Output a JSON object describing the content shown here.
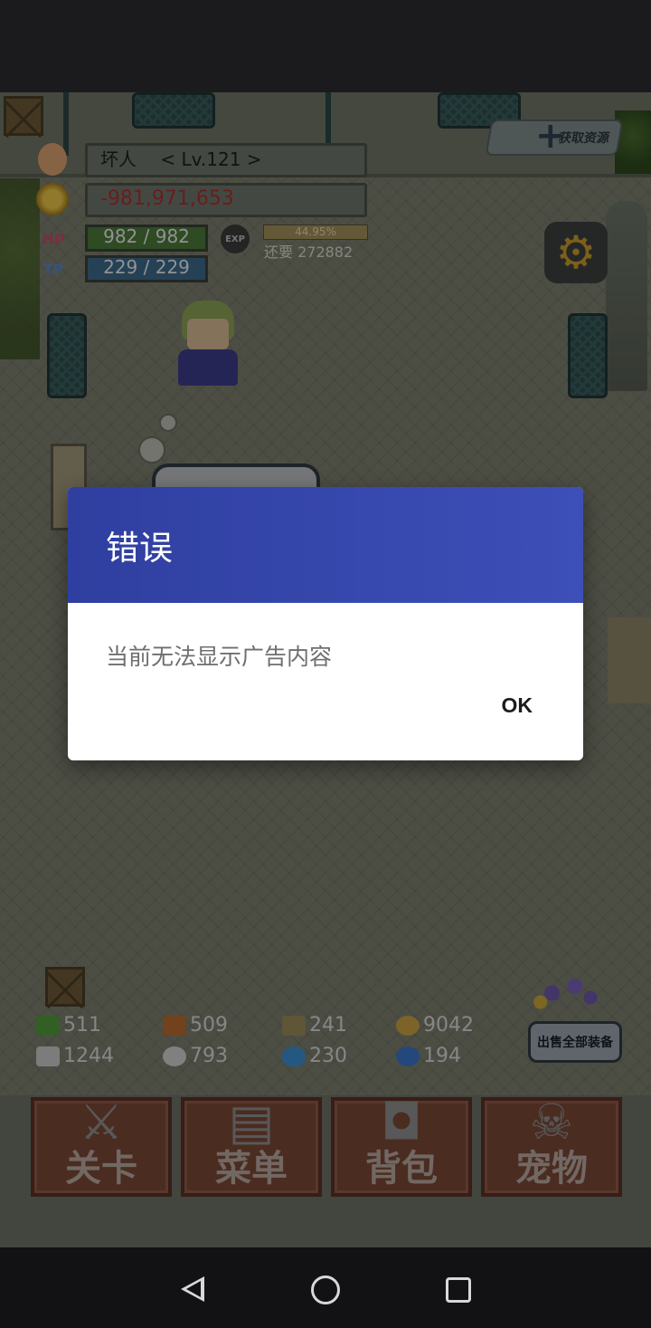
{
  "hud": {
    "player_name": "坏人",
    "level": "< Lv.121 >",
    "gold": "-981,971,653",
    "hp": "982 / 982",
    "tp": "229 / 229",
    "hp_label": "HP",
    "tp_label": "TP",
    "exp_label": "EXP",
    "exp_percent": "44.95%",
    "exp_remaining": "还要 272882"
  },
  "collect_button": {
    "label": "获取资源",
    "icon": "plus-orb-icon"
  },
  "settings_icon": "gear-icon",
  "resources": [
    {
      "icon": "herb-icon",
      "value": "511",
      "color": "#4f9a3a"
    },
    {
      "icon": "wood-icon",
      "value": "509",
      "color": "#b8692f"
    },
    {
      "icon": "cloth-icon",
      "value": "241",
      "color": "#9a8a5a"
    },
    {
      "icon": "drop-icon",
      "value": "9042",
      "color": "#c8a040"
    },
    {
      "icon": "ingot-icon",
      "value": "1244",
      "color": "#c9c9c9"
    },
    {
      "icon": "bone-icon",
      "value": "793",
      "color": "#d0cfcf"
    },
    {
      "icon": "flame-icon",
      "value": "230",
      "color": "#3d8fd0"
    },
    {
      "icon": "orb-icon",
      "value": "194",
      "color": "#3b74c9"
    }
  ],
  "sell_all_button": "出售全部装备",
  "bottom_menu": [
    {
      "label": "关卡",
      "icon": "crossed-swords-icon"
    },
    {
      "label": "菜单",
      "icon": "book-icon"
    },
    {
      "label": "背包",
      "icon": "backpack-icon"
    },
    {
      "label": "宠物",
      "icon": "dragon-skull-icon"
    }
  ],
  "dialog": {
    "title": "错误",
    "message": "当前无法显示广告内容",
    "ok_label": "OK"
  }
}
